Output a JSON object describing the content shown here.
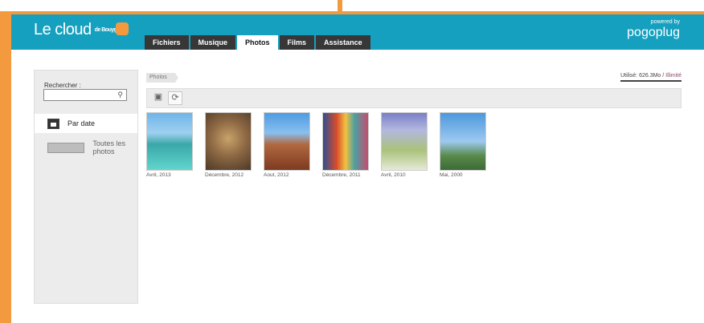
{
  "header": {
    "logo_text": "Le cloud",
    "logo_by": "de Bouygues",
    "powered_by": "powered by",
    "pogoplug": "pogoplug"
  },
  "tabs": [
    {
      "label": "Fichiers"
    },
    {
      "label": "Musique"
    },
    {
      "label": "Photos"
    },
    {
      "label": "Films"
    },
    {
      "label": "Assistance"
    }
  ],
  "sidebar": {
    "search_label": "Rechercher :",
    "search_value": "",
    "items": [
      {
        "label": "Par date",
        "icon": "calendar-icon"
      },
      {
        "label": "Toutes les photos",
        "icon": "photo-stack-icon"
      }
    ]
  },
  "breadcrumb": "Photos",
  "usage": {
    "used": "Utilisé: 626.3Mo / ",
    "limit": "Illimité"
  },
  "toolbar": {
    "icons": [
      "grid-view-icon",
      "refresh-icon"
    ]
  },
  "photos": [
    {
      "caption": "Avril, 2013"
    },
    {
      "caption": "Décembre, 2012"
    },
    {
      "caption": "Aout, 2012"
    },
    {
      "caption": "Décembre, 2011"
    },
    {
      "caption": "Avril, 2010"
    },
    {
      "caption": "Mai, 2000"
    }
  ],
  "colors": {
    "header": "#16a0bf",
    "frame": "#f39a3f",
    "tab_dark": "#373737"
  }
}
